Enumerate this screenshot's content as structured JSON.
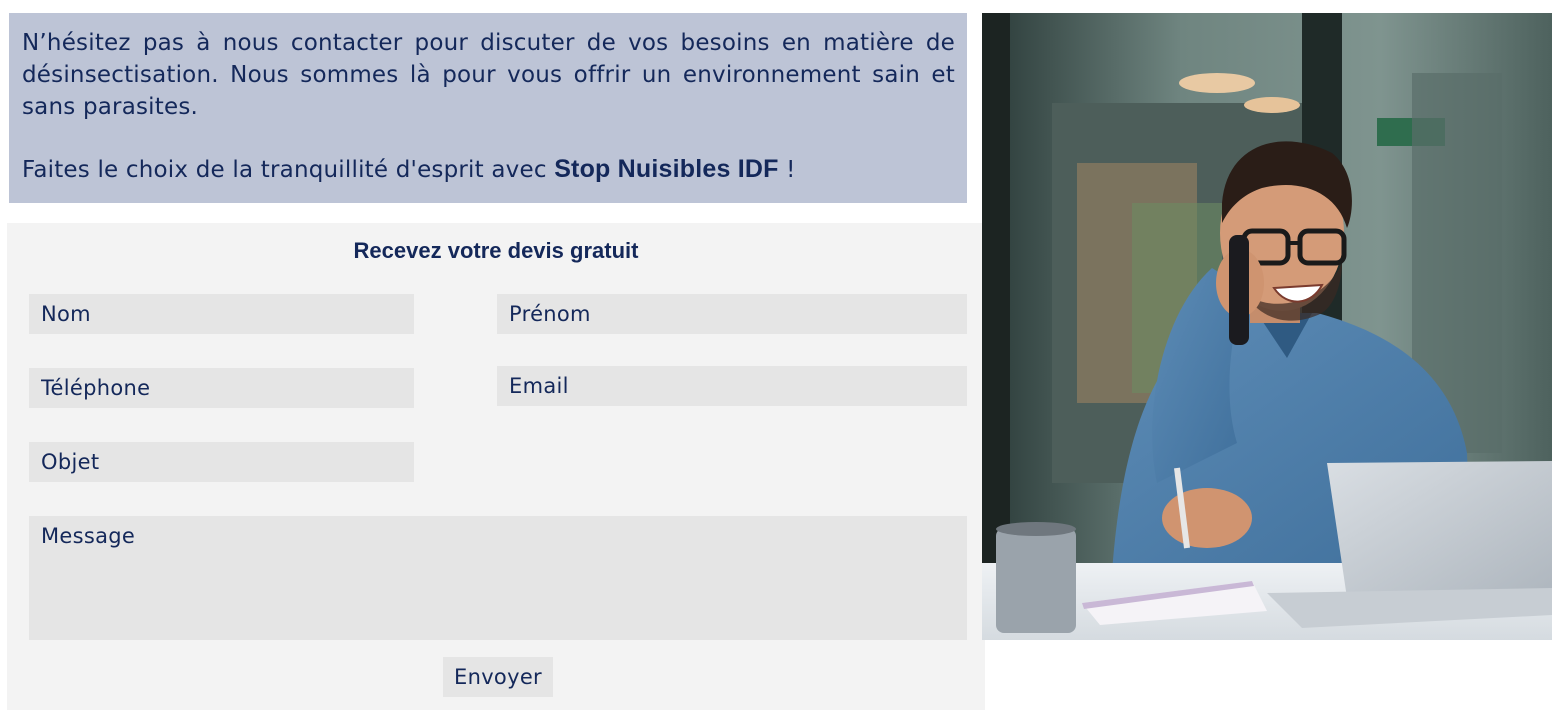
{
  "intro": {
    "paragraph1": "N’hésitez pas à nous contacter pour discuter de vos besoins en matière de désinsectisation. Nous sommes là pour vous offrir un environnement sain et sans parasites.",
    "paragraph2_prefix": "Faites le choix de la tranquillité d'esprit avec ",
    "brand_name": "Stop Nuisibles IDF",
    "paragraph2_suffix": " !"
  },
  "form": {
    "title": "Recevez votre devis gratuit",
    "fields": {
      "nom": {
        "placeholder": "Nom",
        "value": ""
      },
      "prenom": {
        "placeholder": "Prénom",
        "value": ""
      },
      "telephone": {
        "placeholder": "Téléphone",
        "value": ""
      },
      "email": {
        "placeholder": "Email",
        "value": ""
      },
      "objet": {
        "placeholder": "Objet",
        "value": ""
      },
      "message": {
        "placeholder": "Message",
        "value": ""
      }
    },
    "submit_label": "Envoyer"
  },
  "photo": {
    "subject": "smiling man on phone at laptop",
    "icons": [
      "phone-icon",
      "laptop-icon",
      "mug-icon",
      "notebook-icon",
      "pen-icon"
    ]
  },
  "colors": {
    "intro_background": "#bdc4d6",
    "text_navy": "#14285a",
    "form_background": "#f3f3f3",
    "field_background": "#e5e5e5"
  }
}
